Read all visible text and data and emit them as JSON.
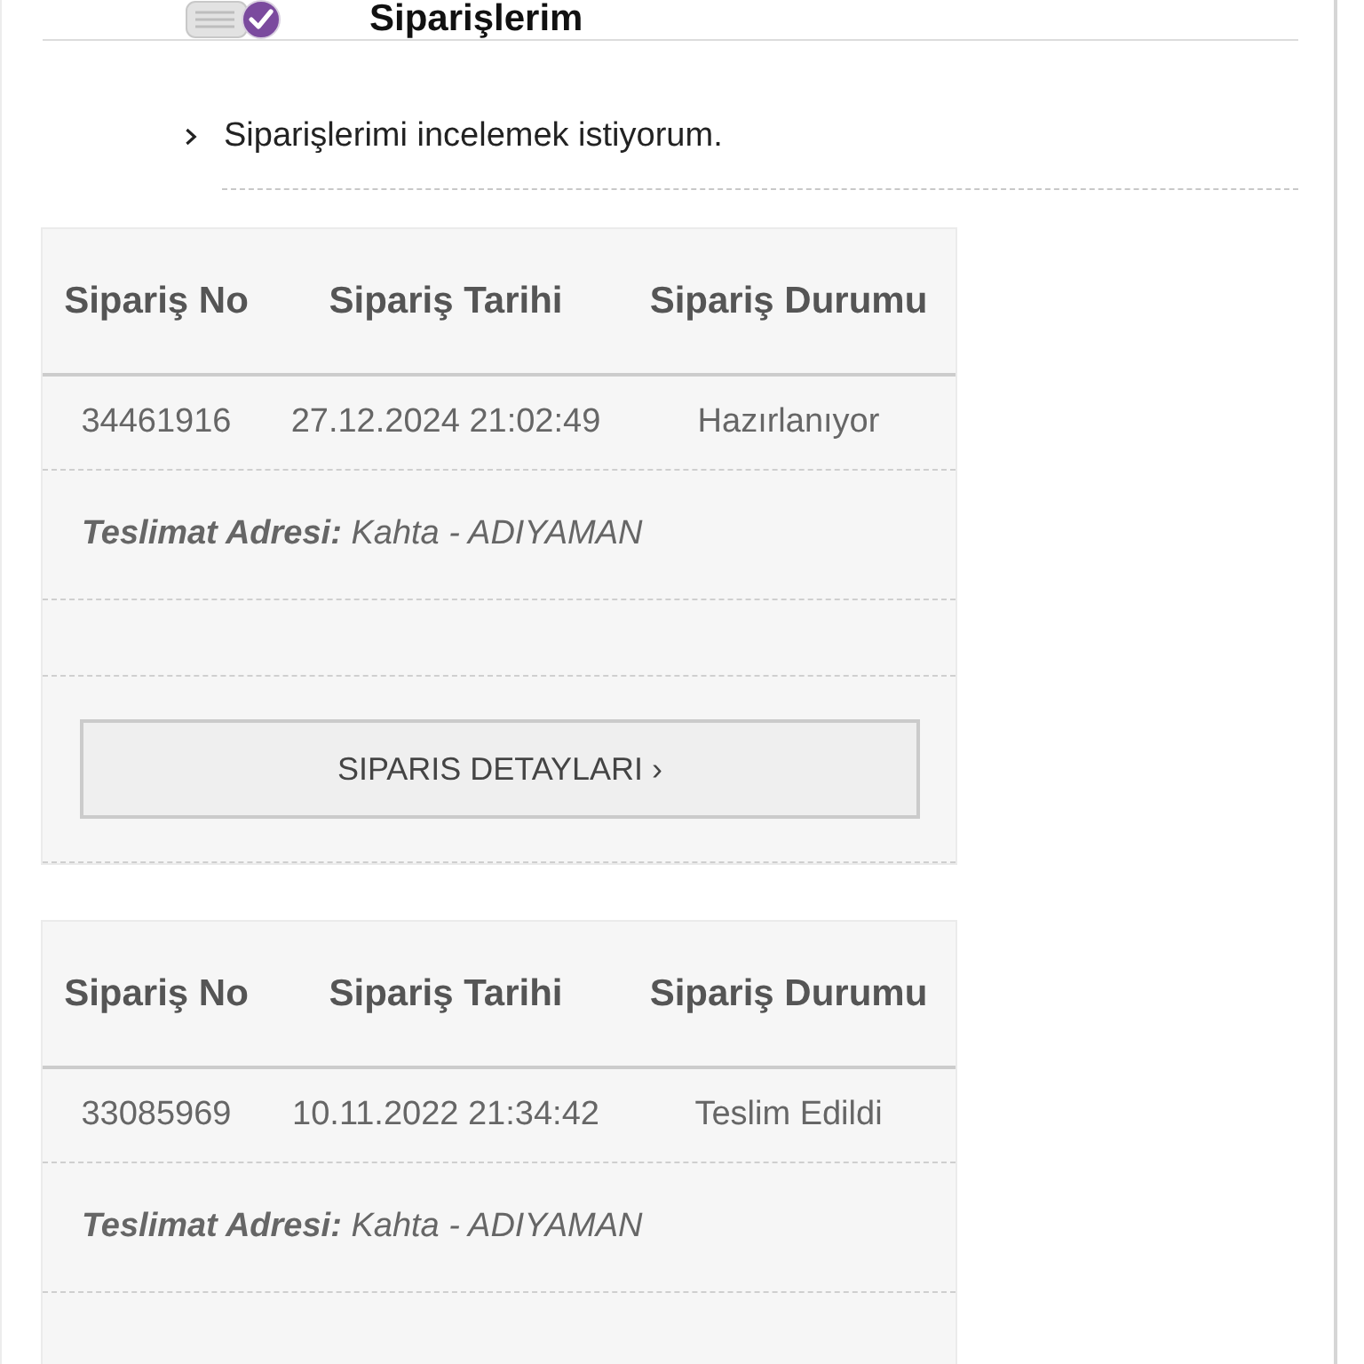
{
  "header": {
    "title": "Siparişlerim"
  },
  "intro": {
    "text": "Siparişlerimi incelemek istiyorum."
  },
  "orders": [
    {
      "columns": [
        "Sipariş No",
        "Sipariş Tarihi",
        "Sipariş Durumu"
      ],
      "row": [
        "34461916",
        "27.12.2024 21:02:49",
        "Hazırlanıyor"
      ],
      "address_label": "Teslimat Adresi:",
      "address": "Kahta - ADIYAMAN",
      "button": "SIPARIS DETAYLARI ›"
    },
    {
      "columns": [
        "Sipariş No",
        "Sipariş Tarihi",
        "Sipariş Durumu"
      ],
      "row": [
        "33085969",
        "10.11.2022 21:34:42",
        "Teslim Edildi"
      ],
      "address_label": "Teslimat Adresi:",
      "address": "Kahta - ADIYAMAN"
    }
  ]
}
